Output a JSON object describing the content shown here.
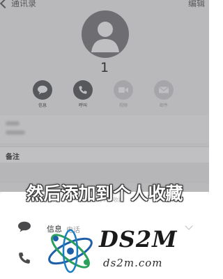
{
  "nav": {
    "back_label": "通讯录",
    "edit_label": "编辑"
  },
  "contact": {
    "number": "1"
  },
  "actions": [
    {
      "label": "信息",
      "icon": "message-icon",
      "enabled": true
    },
    {
      "label": "呼叫",
      "icon": "phone-icon",
      "enabled": true
    },
    {
      "label": "视频",
      "icon": "video-icon",
      "enabled": false
    },
    {
      "label": "邮件",
      "icon": "mail-icon",
      "enabled": false
    }
  ],
  "notes": {
    "label": "备注"
  },
  "caption": "然后添加到个人收藏",
  "sheet": {
    "title": "添加到个人收藏",
    "rows": [
      {
        "icon": "message-icon",
        "label": "信息",
        "sub": "电话"
      }
    ]
  },
  "watermark": {
    "text": "DS2M",
    "sub": "ds2m.com"
  },
  "colors": {
    "dark_action": "#56575a",
    "light_action": "#d6d6d8",
    "overlay": "#5a5a5f"
  }
}
